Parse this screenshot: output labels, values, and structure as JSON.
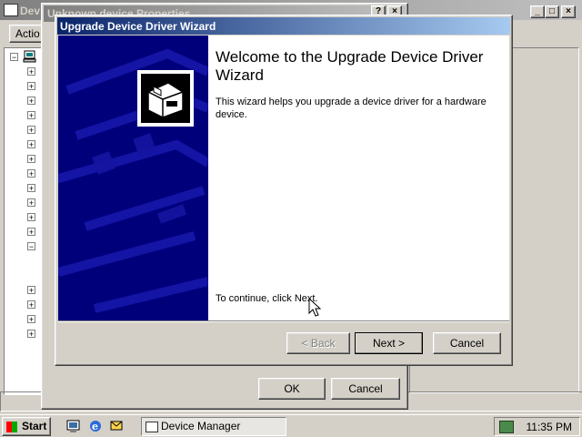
{
  "device_manager": {
    "title": "Dev",
    "action_menu": "Actio"
  },
  "properties_dialog": {
    "title": "Unknown device Properties",
    "help_glyph": "?",
    "close_glyph": "×",
    "ok_label": "OK",
    "cancel_label": "Cancel"
  },
  "wizard": {
    "title": "Upgrade Device Driver Wizard",
    "heading": "Welcome to the Upgrade Device Driver Wizard",
    "description": "This wizard helps you upgrade a device driver for a hardware device.",
    "continue_text": "To continue, click Next.",
    "back_label": "< Back",
    "next_label": "Next >",
    "cancel_label": "Cancel"
  },
  "taskbar": {
    "start_label": "Start",
    "task_label": "Device Manager",
    "clock": "11:35 PM",
    "quicklaunch_icons": [
      "desktop-icon",
      "internet-explorer-icon",
      "outlook-icon"
    ]
  },
  "colors": {
    "active_title_start": "#0a246a",
    "active_title_end": "#a6caf0",
    "wizard_side": "#00007b",
    "face": "#d4d0c8"
  }
}
